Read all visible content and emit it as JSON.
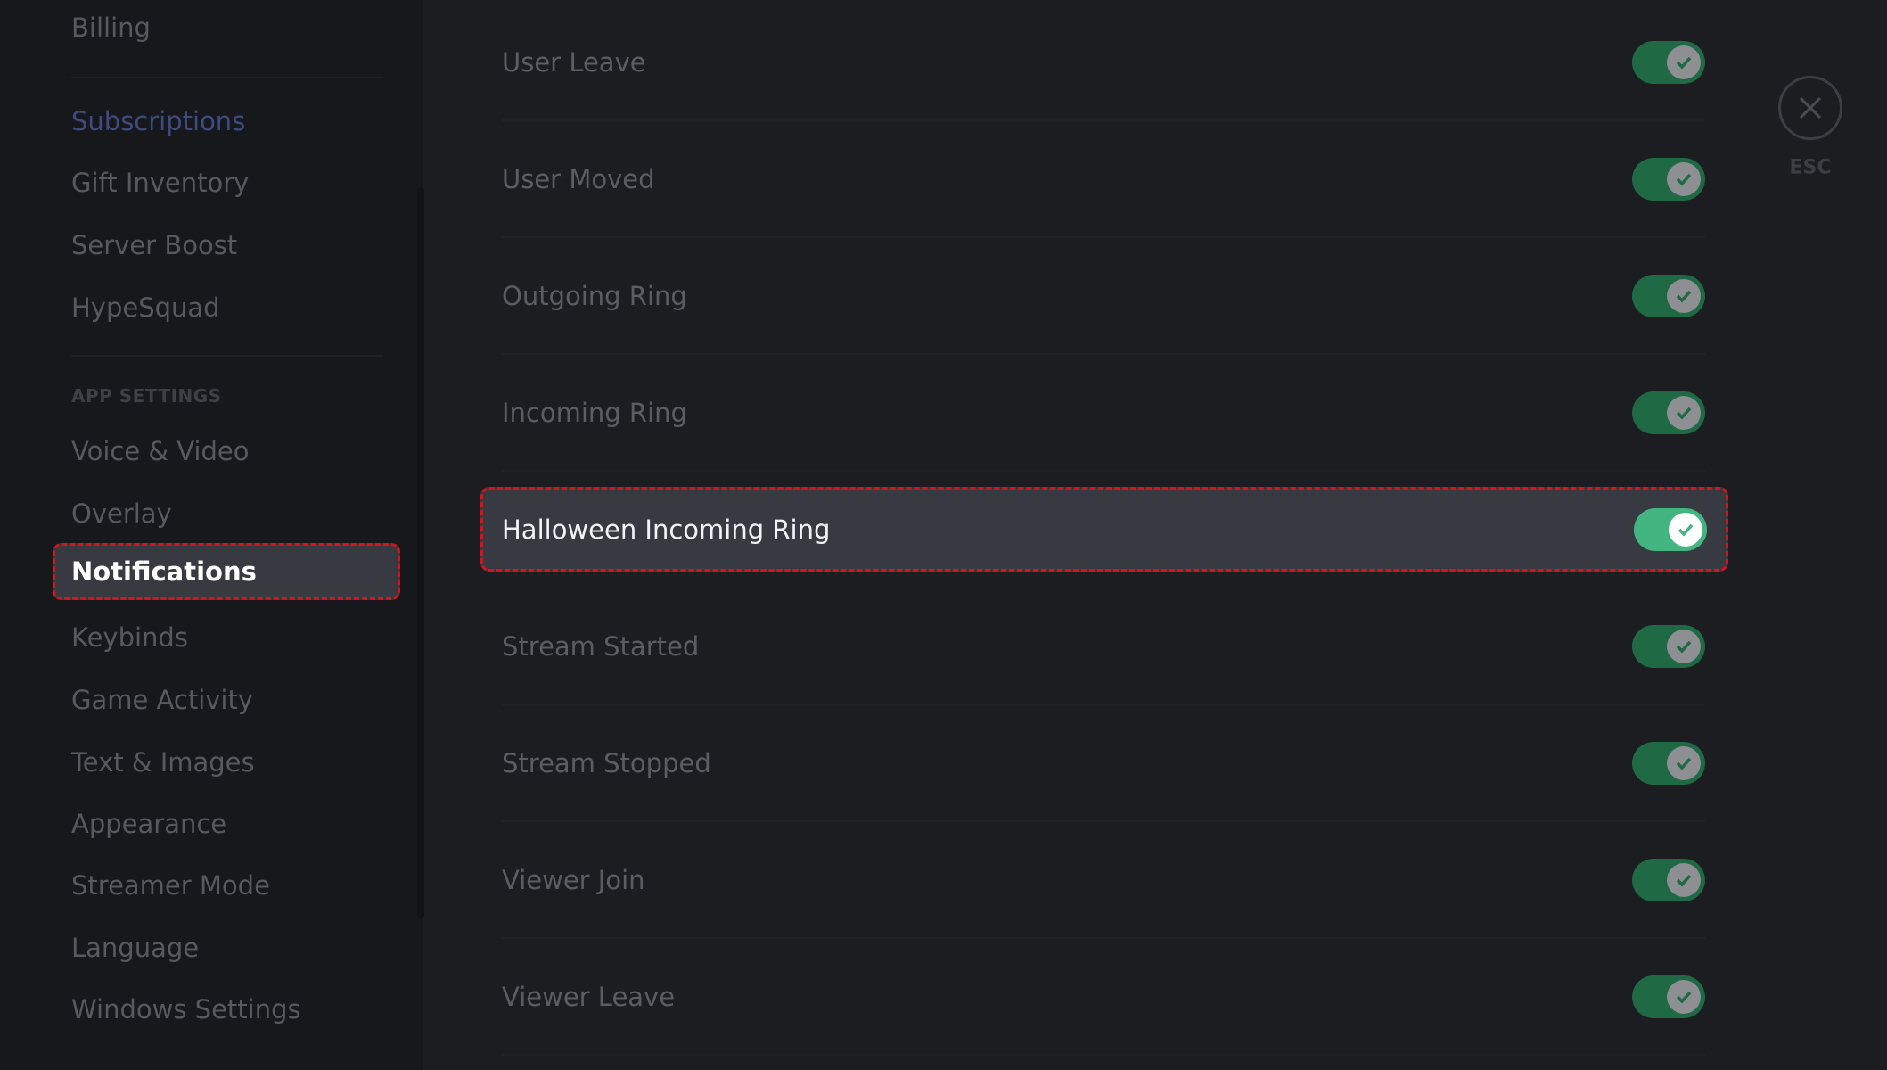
{
  "sidebar": {
    "items": [
      {
        "label": "Billing"
      },
      {
        "label": "Subscriptions"
      },
      {
        "label": "Gift Inventory"
      },
      {
        "label": "Server Boost"
      },
      {
        "label": "HypeSquad"
      },
      {
        "label": "Voice & Video"
      },
      {
        "label": "Overlay"
      },
      {
        "label": "Notifications",
        "selected": true
      },
      {
        "label": "Keybinds"
      },
      {
        "label": "Game Activity"
      },
      {
        "label": "Text & Images"
      },
      {
        "label": "Appearance"
      },
      {
        "label": "Streamer Mode"
      },
      {
        "label": "Language"
      },
      {
        "label": "Windows Settings"
      }
    ],
    "section_header": "APP SETTINGS"
  },
  "sounds": [
    {
      "label": "User Leave",
      "enabled": true
    },
    {
      "label": "User Moved",
      "enabled": true
    },
    {
      "label": "Outgoing Ring",
      "enabled": true
    },
    {
      "label": "Incoming Ring",
      "enabled": true
    },
    {
      "label": "Halloween Incoming Ring",
      "enabled": true,
      "highlighted": true
    },
    {
      "label": "Stream Started",
      "enabled": true
    },
    {
      "label": "Stream Stopped",
      "enabled": true
    },
    {
      "label": "Viewer Join",
      "enabled": true
    },
    {
      "label": "Viewer Leave",
      "enabled": true
    }
  ],
  "close": {
    "label": "ESC",
    "icon": "close-icon"
  },
  "colors": {
    "toggle_on": "#43b581",
    "highlight": "#e0101a",
    "accent_link": "#3f4a7e"
  }
}
